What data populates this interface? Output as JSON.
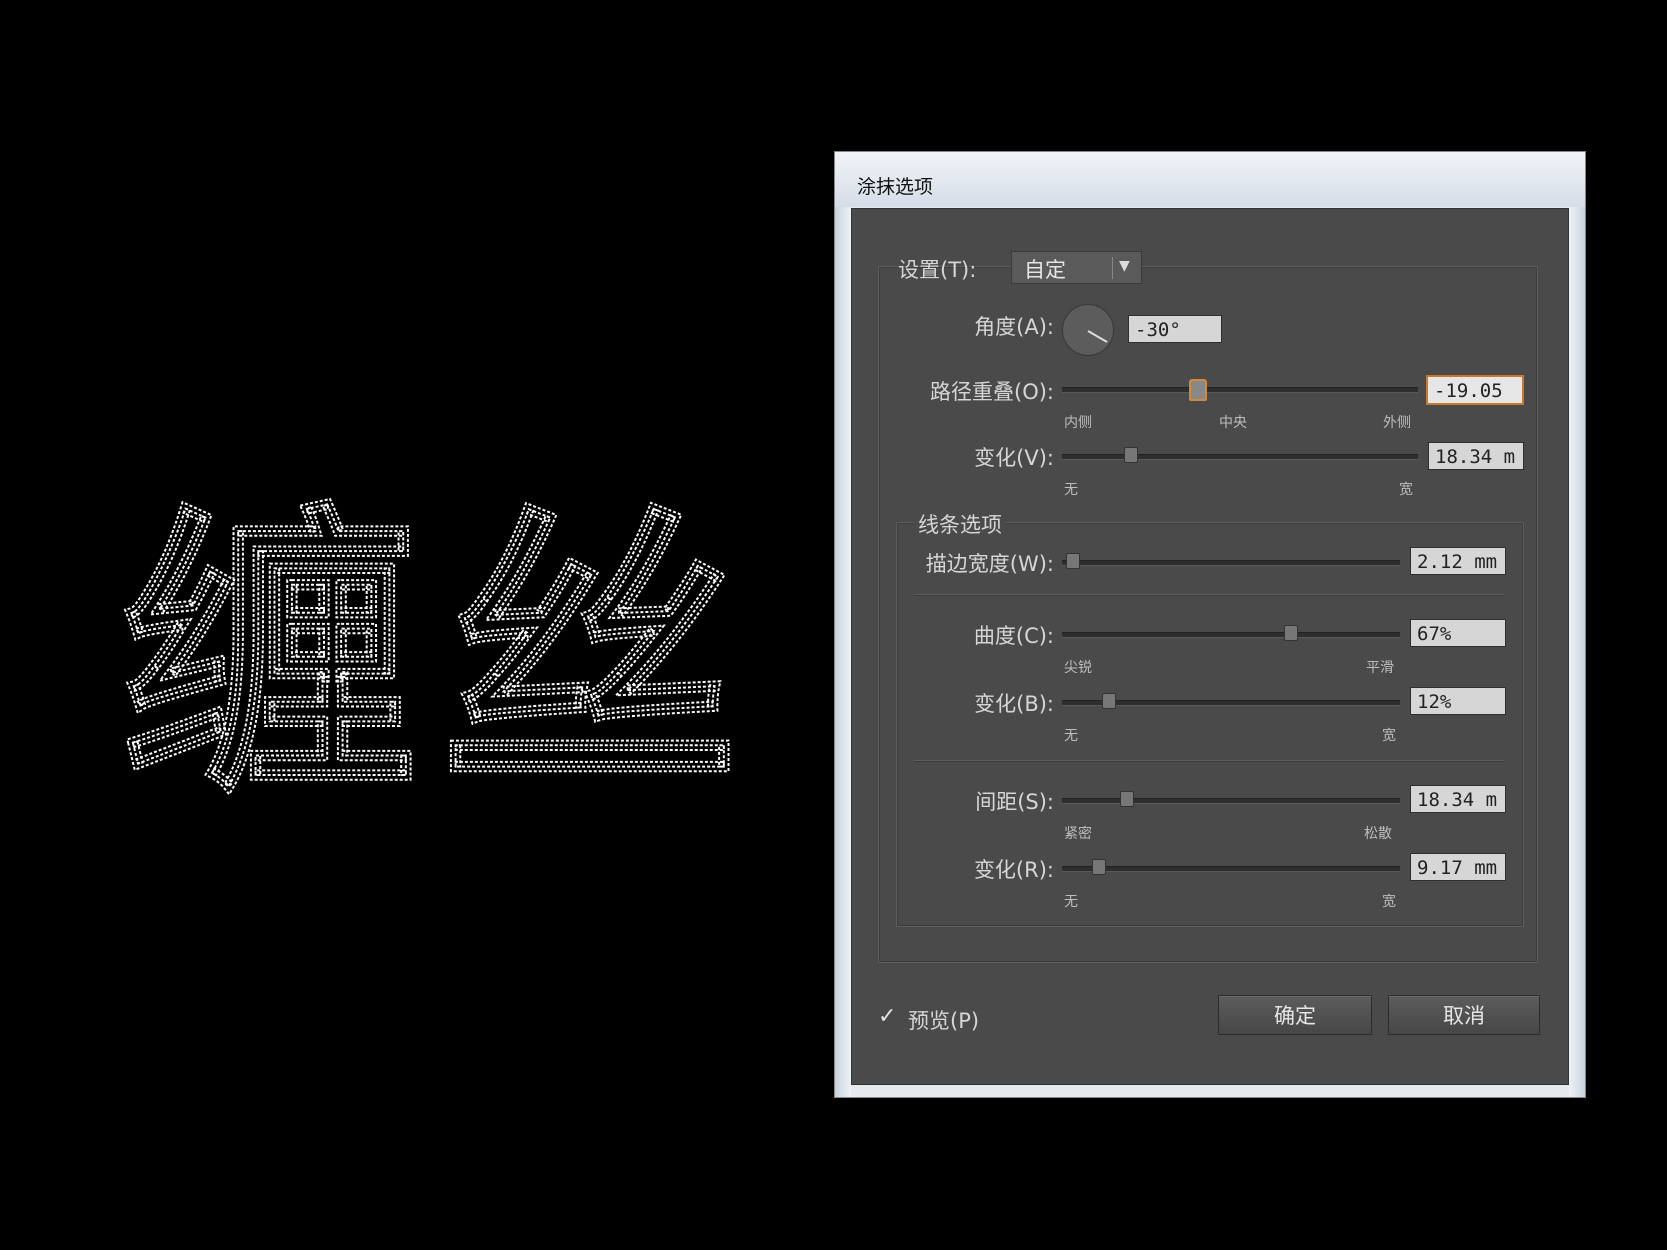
{
  "artwork": {
    "text": "缠丝"
  },
  "dialog": {
    "title": "涂抹选项",
    "settings": {
      "label": "设置(T):",
      "value": "自定"
    },
    "angle": {
      "label": "角度(A):",
      "value": "-30°"
    },
    "path_overlap": {
      "label": "路径重叠(O):",
      "value": "-19.05",
      "min_label": "内侧",
      "mid_label": "中央",
      "max_label": "外侧"
    },
    "variation_v": {
      "label": "变化(V):",
      "value": "18.34 m",
      "min_label": "无",
      "max_label": "宽"
    },
    "line_options": {
      "title": "线条选项",
      "stroke_width": {
        "label": "描边宽度(W):",
        "value": "2.12 mm"
      },
      "curviness": {
        "label": "曲度(C):",
        "value": "67%",
        "min_label": "尖锐",
        "max_label": "平滑"
      },
      "variation_b": {
        "label": "变化(B):",
        "value": "12%",
        "min_label": "无",
        "max_label": "宽"
      },
      "spacing": {
        "label": "间距(S):",
        "value": "18.34 m",
        "min_label": "紧密",
        "max_label": "松散"
      },
      "variation_r": {
        "label": "变化(R):",
        "value": "9.17 mm",
        "min_label": "无",
        "max_label": "宽"
      }
    },
    "preview": {
      "label": "预览(P)",
      "checked": true
    },
    "ok_label": "确定",
    "cancel_label": "取消"
  }
}
